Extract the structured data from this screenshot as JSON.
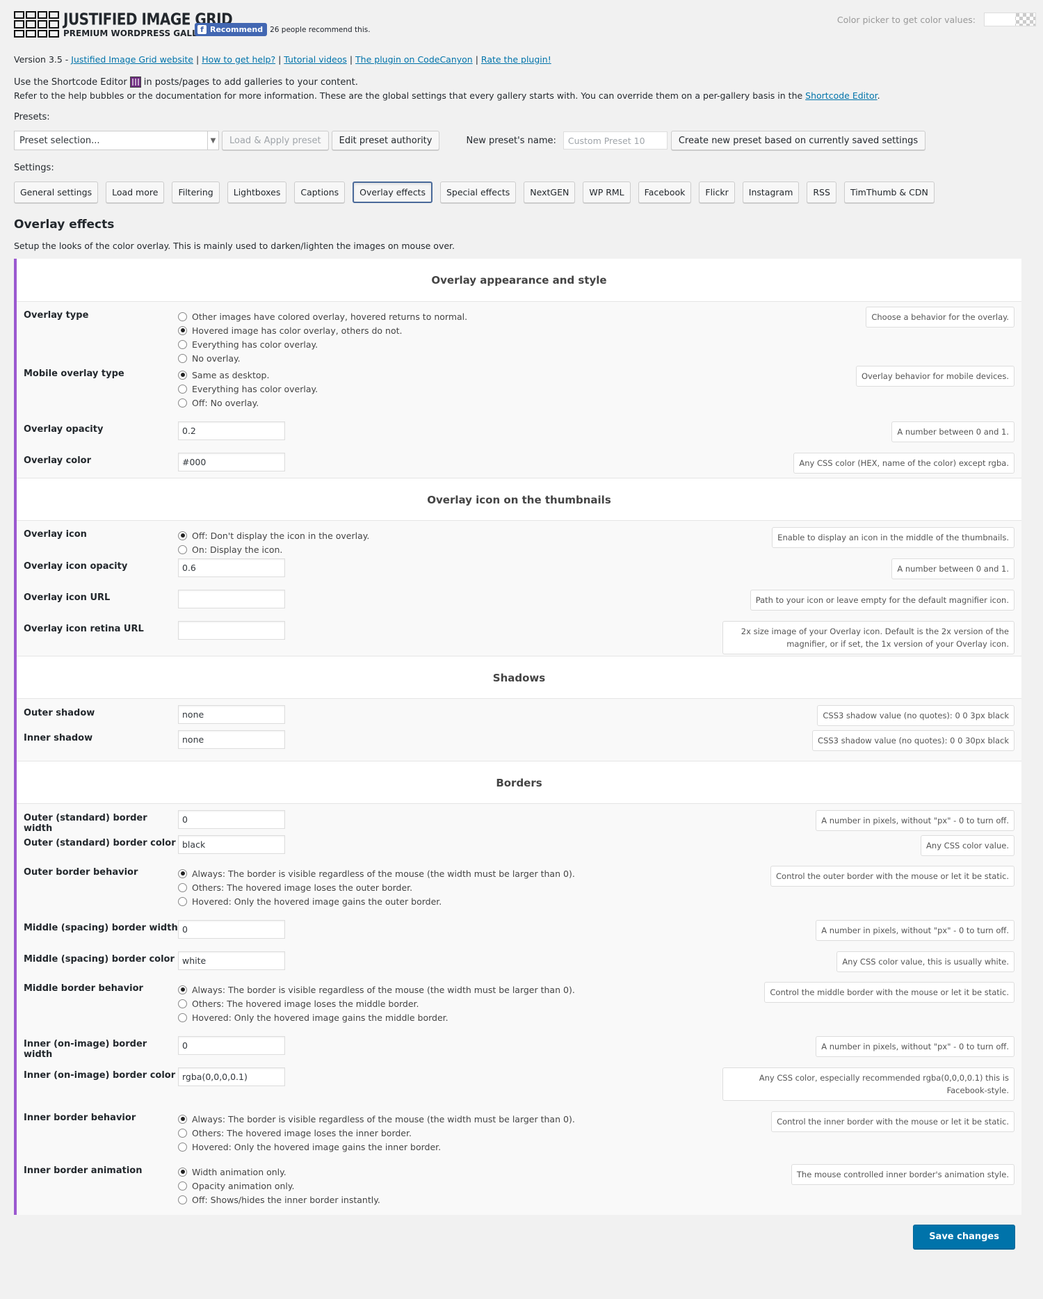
{
  "header": {
    "logo_title": "JUSTIFIED IMAGE GRID",
    "logo_subtitle": "PREMIUM WORDPRESS GALLERY",
    "fb_button": "Recommend",
    "fb_count": "26 people recommend this.",
    "color_picker_label": "Color picker to get color values:"
  },
  "version": {
    "prefix": "Version 3.5 - ",
    "links": [
      "Justified Image Grid website",
      "How to get help?",
      "Tutorial videos",
      "The plugin on CodeCanyon",
      "Rate the plugin!"
    ]
  },
  "intro": {
    "line1_a": "Use the Shortcode Editor",
    "line1_b": "in posts/pages to add galleries to your content.",
    "line2": "Refer to the help bubbles or the documentation for more information. These are the global settings that every gallery starts with. You can override them on a per-gallery basis in the ",
    "line2_link": "Shortcode Editor",
    "line2_end": "."
  },
  "presets": {
    "label": "Presets:",
    "select_value": "Preset selection...",
    "load_apply": "Load & Apply preset",
    "edit_authority": "Edit preset authority",
    "new_name_label": "New preset's name:",
    "new_name_placeholder": "Custom Preset 10",
    "create_button": "Create new preset based on currently saved settings"
  },
  "settings_label": "Settings:",
  "tabs": [
    "General settings",
    "Load more",
    "Filtering",
    "Lightboxes",
    "Captions",
    "Overlay effects",
    "Special effects",
    "NextGEN",
    "WP RML",
    "Facebook",
    "Flickr",
    "Instagram",
    "RSS",
    "TimThumb & CDN"
  ],
  "section": {
    "title": "Overlay effects",
    "description": "Setup the looks of the color overlay. This is mainly used to darken/lighten the images on mouse over."
  },
  "groups": {
    "appearance": "Overlay appearance and style",
    "icon": "Overlay icon on the thumbnails",
    "shadows": "Shadows",
    "borders": "Borders"
  },
  "fields": {
    "overlay_type": {
      "label": "Overlay type",
      "options": [
        "Other images have colored overlay, hovered returns to normal.",
        "Hovered image has color overlay, others do not.",
        "Everything has color overlay.",
        "No overlay."
      ],
      "help": "Choose a behavior for the overlay."
    },
    "mobile_overlay_type": {
      "label": "Mobile overlay type",
      "options": [
        "Same as desktop.",
        "Everything has color overlay.",
        "Off: No overlay."
      ],
      "help": "Overlay behavior for mobile devices."
    },
    "overlay_opacity": {
      "label": "Overlay opacity",
      "value": "0.2",
      "help": "A number between 0 and 1."
    },
    "overlay_color": {
      "label": "Overlay color",
      "value": "#000",
      "help": "Any CSS color (HEX, name of the color) except rgba."
    },
    "overlay_icon": {
      "label": "Overlay icon",
      "options": [
        "Off: Don't display the icon in the overlay.",
        "On: Display the icon."
      ],
      "help": "Enable to display an icon in the middle of the thumbnails."
    },
    "overlay_icon_opacity": {
      "label": "Overlay icon opacity",
      "value": "0.6",
      "help": "A number between 0 and 1."
    },
    "overlay_icon_url": {
      "label": "Overlay icon URL",
      "value": "",
      "help": "Path to your icon or leave empty for the default magnifier icon."
    },
    "overlay_icon_retina_url": {
      "label": "Overlay icon retina URL",
      "value": "",
      "help": "2x size image of your Overlay icon. Default is the 2x version of the magnifier, or if set, the 1x version of your Overlay icon."
    },
    "outer_shadow": {
      "label": "Outer shadow",
      "value": "none",
      "help": "CSS3 shadow value (no quotes): 0 0 3px black"
    },
    "inner_shadow": {
      "label": "Inner shadow",
      "value": "none",
      "help": "CSS3 shadow value (no quotes): 0 0 30px black"
    },
    "outer_border_width": {
      "label": "Outer (standard) border width",
      "value": "0",
      "help": "A number in pixels, without \"px\" - 0 to turn off."
    },
    "outer_border_color": {
      "label": "Outer (standard) border color",
      "value": "black",
      "help": "Any CSS color value."
    },
    "outer_border_behavior": {
      "label": "Outer border behavior",
      "options": [
        "Always: The border is visible regardless of the mouse (the width must be larger than 0).",
        "Others: The hovered image loses the outer border.",
        "Hovered: Only the hovered image gains the outer border."
      ],
      "help": "Control the outer border with the mouse or let it be static."
    },
    "middle_border_width": {
      "label": "Middle (spacing) border width",
      "value": "0",
      "help": "A number in pixels, without \"px\" - 0 to turn off."
    },
    "middle_border_color": {
      "label": "Middle (spacing) border color",
      "value": "white",
      "help": "Any CSS color value, this is usually white."
    },
    "middle_border_behavior": {
      "label": "Middle border behavior",
      "options": [
        "Always: The border is visible regardless of the mouse (the width must be larger than 0).",
        "Others: The hovered image loses the middle border.",
        "Hovered: Only the hovered image gains the middle border."
      ],
      "help": "Control the middle border with the mouse or let it be static."
    },
    "inner_border_width": {
      "label": "Inner (on-image) border width",
      "value": "0",
      "help": "A number in pixels, without \"px\" - 0 to turn off."
    },
    "inner_border_color": {
      "label": "Inner (on-image) border color",
      "value": "rgba(0,0,0,0.1)",
      "help": "Any CSS color, especially recommended rgba(0,0,0,0.1) this is Facebook-style."
    },
    "inner_border_behavior": {
      "label": "Inner border behavior",
      "options": [
        "Always: The border is visible regardless of the mouse (the width must be larger than 0).",
        "Others: The hovered image loses the inner border.",
        "Hovered: Only the hovered image gains the inner border."
      ],
      "help": "Control the inner border with the mouse or let it be static."
    },
    "inner_border_animation": {
      "label": "Inner border animation",
      "options": [
        "Width animation only.",
        "Opacity animation only.",
        "Off: Shows/hides the inner border instantly."
      ],
      "help": "The mouse controlled inner border's animation style."
    }
  },
  "save_button": "Save changes",
  "colors": {
    "accent": "#9b59d0",
    "primary": "#0073aa",
    "facebook": "#4267b2"
  }
}
